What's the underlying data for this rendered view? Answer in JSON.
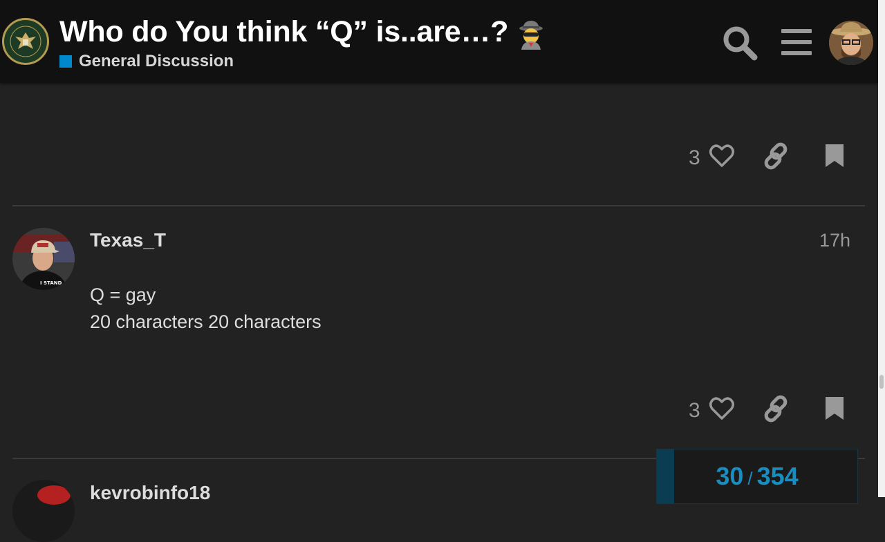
{
  "header": {
    "title": "Who do You think “Q” is..are…?",
    "title_emoji": "detective-emoji",
    "category": "General Discussion",
    "category_color": "#0088cc",
    "logo": "infowars-army-seal",
    "logo_text": "INFOWARS ARMY"
  },
  "posts": [
    {
      "likes": "3"
    },
    {
      "username": "Texas_T",
      "time": "17h",
      "body": [
        "Q = gay",
        "20 characters 20 characters"
      ],
      "likes": "3"
    },
    {
      "username": "kevrobinfo18"
    }
  ],
  "timeline": {
    "current": "30",
    "separator": "/",
    "total": "354",
    "fraction": 0.0847
  },
  "colors": {
    "background": "#222222",
    "header": "#111111",
    "accent": "#1a8dc0"
  }
}
